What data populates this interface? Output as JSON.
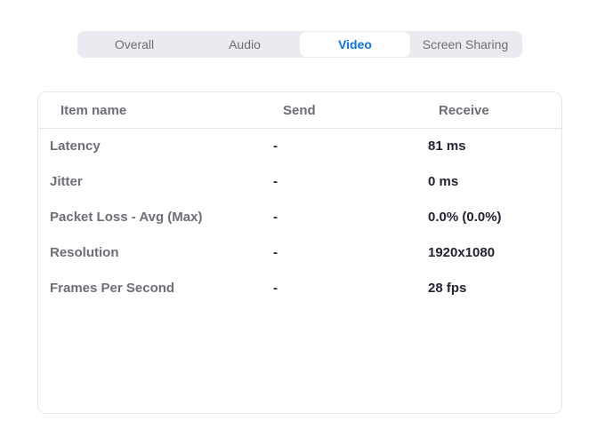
{
  "tabs": [
    {
      "label": "Overall",
      "active": false
    },
    {
      "label": "Audio",
      "active": false
    },
    {
      "label": "Video",
      "active": true
    },
    {
      "label": "Screen Sharing",
      "active": false
    }
  ],
  "table": {
    "headers": {
      "item_name": "Item name",
      "send": "Send",
      "receive": "Receive"
    },
    "rows": [
      {
        "name": "Latency",
        "send": "-",
        "receive": "81 ms"
      },
      {
        "name": "Jitter",
        "send": "-",
        "receive": "0 ms"
      },
      {
        "name": "Packet Loss - Avg (Max)",
        "send": "-",
        "receive": "0.0% (0.0%)"
      },
      {
        "name": "Resolution",
        "send": "-",
        "receive": "1920x1080"
      },
      {
        "name": "Frames Per Second",
        "send": "-",
        "receive": "28 fps"
      }
    ]
  },
  "colors": {
    "accent": "#0e71eb",
    "tab_bar_bg": "#eaeaf0",
    "label_gray": "#6e6e76",
    "value_dark": "#232333",
    "border": "#e6e6ea"
  }
}
